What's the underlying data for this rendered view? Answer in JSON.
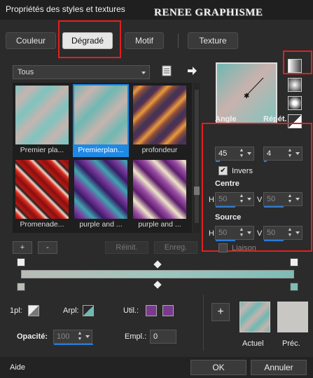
{
  "window": {
    "title": "Propriétés des styles et textures",
    "watermark": "RENEE GRAPHISME"
  },
  "tabs": [
    {
      "label": "Couleur",
      "active": false
    },
    {
      "label": "Dégradé",
      "active": true
    },
    {
      "label": "Motif",
      "active": false
    },
    {
      "label": "Texture",
      "active": false
    }
  ],
  "category": {
    "selected": "Tous"
  },
  "gallery": [
    {
      "caption": "Premier pla...",
      "selected": false
    },
    {
      "caption": "Premierplan...",
      "selected": true
    },
    {
      "caption": "profondeur",
      "selected": false
    },
    {
      "caption": "Promenade...",
      "selected": false
    },
    {
      "caption": "purple and ...",
      "selected": false
    },
    {
      "caption": "purple and ...",
      "selected": false
    }
  ],
  "preset_buttons": {
    "add": "+",
    "remove": "-",
    "reset": "Réinit.",
    "save": "Enreg."
  },
  "properties": {
    "angle_label": "Angle",
    "angle": "45",
    "repeat_label": "Répét.",
    "repeat": "4",
    "invert_label": "Invers",
    "invert_checked": true,
    "center_label": "Centre",
    "center_h_label": "H",
    "center_h": "50",
    "center_v_label": "V",
    "center_v": "50",
    "source_label": "Source",
    "source_h_label": "H",
    "source_h": "50",
    "source_v_label": "V",
    "source_v": "50",
    "link_label": "Liaison"
  },
  "bottom_controls": {
    "fg_label": "1pl:",
    "bg_label": "Arpl:",
    "use_label": "Util.:",
    "opacity_label": "Opacité:",
    "opacity": "100",
    "location_label": "Empl.:",
    "location": "0"
  },
  "swatches": {
    "current_label": "Actuel",
    "previous_label": "Préc.",
    "add": "+"
  },
  "footer": {
    "help": "Aide",
    "ok": "OK",
    "cancel": "Annuler"
  },
  "colors": {
    "accent": "#1e88e5",
    "highlight": "#e02020",
    "purple": "#7a3b8e",
    "teal": "#6fb8b3",
    "gray": "#c9c7c3"
  }
}
